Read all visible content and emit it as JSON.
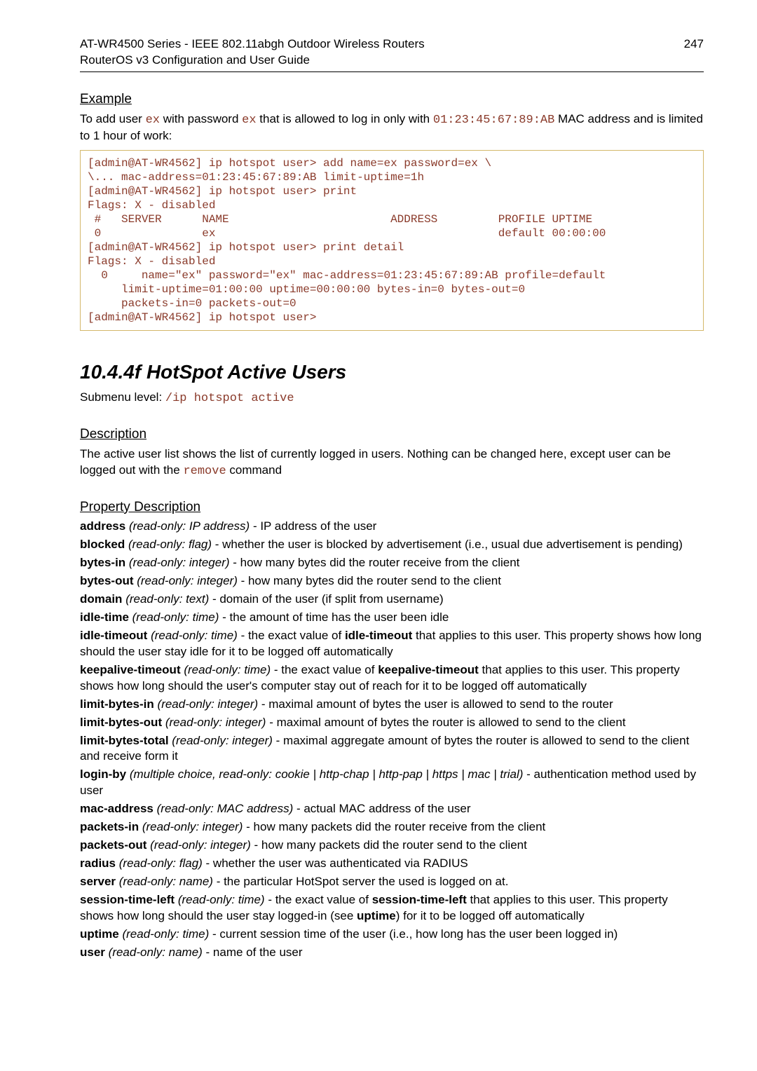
{
  "header": {
    "left": "AT-WR4500 Series - IEEE 802.11abgh Outdoor Wireless Routers\nRouterOS v3 Configuration and User Guide",
    "pageno": "247"
  },
  "example": {
    "heading": "Example",
    "intro_pre": "To add user ",
    "user": "ex",
    "intro_mid1": " with password ",
    "pass": "ex",
    "intro_mid2": " that is allowed to log in only with ",
    "mac": "01:23:45:67:89:AB",
    "intro_mid3": " MAC address and is limited to 1 hour of work:",
    "code": "[admin@AT-WR4562] ip hotspot user> add name=ex password=ex \\\n\\... mac-address=01:23:45:67:89:AB limit-uptime=1h\n[admin@AT-WR4562] ip hotspot user> print\nFlags: X - disabled\n #   SERVER      NAME                        ADDRESS         PROFILE UPTIME\n 0               ex                                          default 00:00:00\n[admin@AT-WR4562] ip hotspot user> print detail\nFlags: X - disabled\n  0     name=\"ex\" password=\"ex\" mac-address=01:23:45:67:89:AB profile=default\n     limit-uptime=01:00:00 uptime=00:00:00 bytes-in=0 bytes-out=0\n     packets-in=0 packets-out=0\n[admin@AT-WR4562] ip hotspot user>"
  },
  "section": {
    "number_title": "10.4.4f   HotSpot Active Users",
    "submenu_pre": "Submenu level: ",
    "submenu_cmd": "/ip hotspot active"
  },
  "description": {
    "heading": "Description",
    "text_pre": "The active user list shows the list of currently logged in users. Nothing can be changed here, except user can be logged out with the ",
    "cmd": "remove",
    "text_post": " command"
  },
  "props_heading": "Property Description",
  "props": {
    "p1": {
      "name": "address",
      "def": "(read-only: IP address)",
      "desc": " - IP address of the user"
    },
    "p2": {
      "name": "blocked",
      "def": "(read-only: flag)",
      "desc": " - whether the user is blocked by advertisement (i.e., usual due advertisement is pending)"
    },
    "p3": {
      "name": "bytes-in",
      "def": "(read-only: integer)",
      "desc": " - how many bytes did the router receive from the client"
    },
    "p4": {
      "name": "bytes-out",
      "def": "(read-only: integer)",
      "desc": " - how many bytes did the router send to the client"
    },
    "p5": {
      "name": "domain",
      "def": "(read-only: text)",
      "desc": " - domain of the user (if split from username)"
    },
    "p6": {
      "name": "idle-time",
      "def": "(read-only: time)",
      "desc": " - the amount of time has the user been idle"
    },
    "p7": {
      "name": "idle-timeout",
      "def": "(read-only: time)",
      "desc_pre": " - the exact value of ",
      "inner": "idle-timeout",
      "desc_post": " that applies to this user. This property shows how long should the user stay idle for it to be logged off automatically"
    },
    "p8": {
      "name": "keepalive-timeout",
      "def": "(read-only: time)",
      "desc_pre": " - the exact value of ",
      "inner": "keepalive-timeout",
      "desc_post": " that applies to this user. This property shows how long should the user's computer stay out of reach for it to be logged off automatically"
    },
    "p9": {
      "name": "limit-bytes-in",
      "def": "(read-only: integer)",
      "desc": " - maximal amount of bytes the user is allowed to send to the router"
    },
    "p10": {
      "name": "limit-bytes-out",
      "def": "(read-only: integer)",
      "desc": " - maximal amount of bytes the router is allowed to send to the client"
    },
    "p11": {
      "name": "limit-bytes-total",
      "def": "(read-only: integer)",
      "desc": " - maximal aggregate amount of bytes the router is allowed to send to the client and receive form it"
    },
    "p12": {
      "name": "login-by",
      "def": "(multiple choice, read-only: cookie | http-chap | http-pap | https | mac | trial)",
      "desc": " - authentication method used by user"
    },
    "p13": {
      "name": "mac-address",
      "def": "(read-only: MAC address)",
      "desc": " - actual MAC address of the user"
    },
    "p14": {
      "name": "packets-in",
      "def": "(read-only: integer)",
      "desc": " - how many packets did the router receive from the client"
    },
    "p15": {
      "name": "packets-out",
      "def": "(read-only: integer)",
      "desc": " - how many packets did the router send to the client"
    },
    "p16": {
      "name": "radius",
      "def": "(read-only: flag)",
      "desc": " - whether the user was authenticated via RADIUS"
    },
    "p17": {
      "name": "server",
      "def": "(read-only: name)",
      "desc": " - the particular HotSpot server the used is logged on at."
    },
    "p18": {
      "name": "session-time-left",
      "def": "(read-only: time)",
      "desc_pre": " - the exact value of ",
      "inner": "session-time-left",
      "desc_mid": " that applies to this user. This property shows how long should the user stay logged-in (see ",
      "inner2": "uptime",
      "desc_post": ") for it to be logged off automatically"
    },
    "p19": {
      "name": "uptime",
      "def": "(read-only: time)",
      "desc": " - current session time of the user (i.e., how long has the user been logged in)"
    },
    "p20": {
      "name": "user",
      "def": "(read-only: name)",
      "desc": " - name of the user"
    }
  }
}
